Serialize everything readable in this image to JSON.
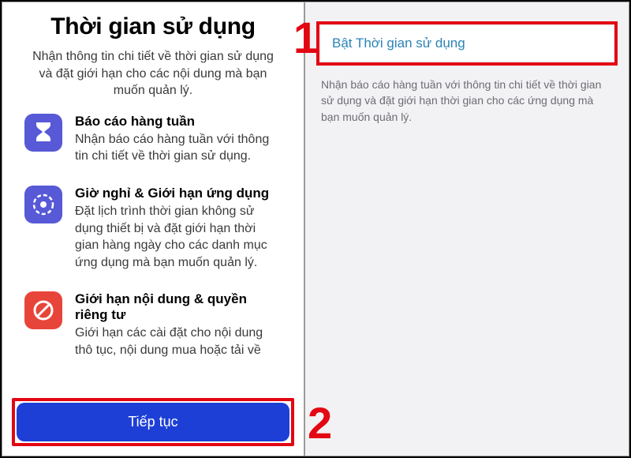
{
  "left": {
    "title": "Thời gian sử dụng",
    "subtitle": "Nhận thông tin chi tiết về thời gian sử dụng và đặt giới hạn cho các nội dung mà bạn muốn quản lý.",
    "features": {
      "weekly": {
        "title": "Báo cáo hàng tuần",
        "desc": "Nhận báo cáo hàng tuần với thông tin chi tiết về thời gian sử dụng."
      },
      "downtime": {
        "title": "Giờ nghỉ & Giới hạn ứng dụng",
        "desc": "Đặt lịch trình thời gian không sử dụng thiết bị và đặt giới hạn thời gian hàng ngày cho các danh mục ứng dụng mà bạn muốn quản lý."
      },
      "content": {
        "title": "Giới hạn nội dung & quyền riêng tư",
        "desc": "Giới hạn các cài đặt cho nội dung thô tục, nội dung mua hoặc tải về"
      }
    },
    "continue_label": "Tiếp tục"
  },
  "right": {
    "enable_label": "Bật Thời gian sử dụng",
    "desc": "Nhận báo cáo hàng tuần với thông tin chi tiết về thời gian sử dụng và đặt giới hạn thời gian cho các ứng dụng mà bạn muốn quản lý."
  },
  "callouts": {
    "one": "1",
    "two": "2"
  },
  "colors": {
    "accent_red": "#e30613",
    "accent_blue": "#1d3fd6",
    "icon_purple": "#5759d6",
    "icon_red": "#e8453a",
    "link_teal": "#2b83b8"
  }
}
